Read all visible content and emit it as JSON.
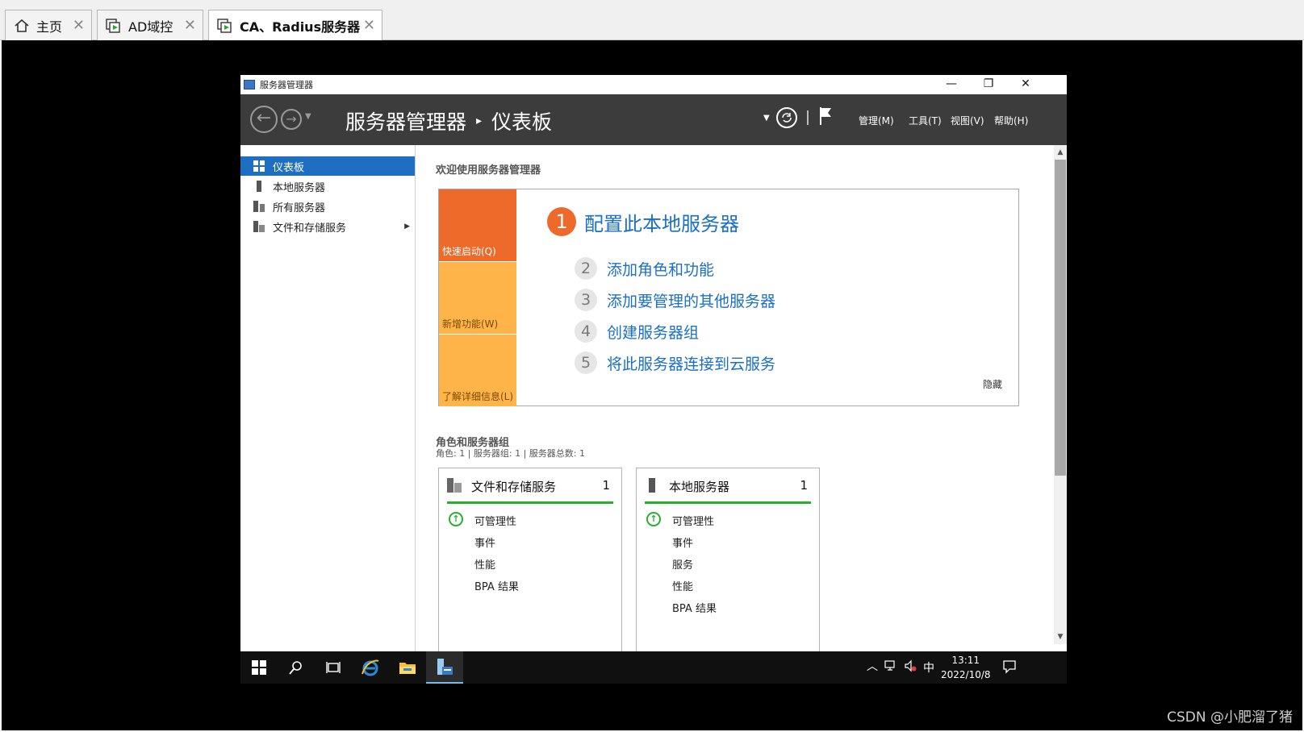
{
  "vm_tabs": [
    {
      "label": "主页"
    },
    {
      "label": "AD域控"
    },
    {
      "label": "CA、Radius服务器"
    }
  ],
  "window": {
    "title": "服务器管理器",
    "controls": {
      "minimize": "—",
      "restore": "❐",
      "close": "✕"
    }
  },
  "header": {
    "breadcrumb_app": "服务器管理器",
    "breadcrumb_sep": "▸",
    "breadcrumb_page": "仪表板",
    "menus": [
      "管理(M)",
      "工具(T)",
      "视图(V)",
      "帮助(H)"
    ],
    "refresh_icon": "refresh-icon",
    "flag_icon": "flag-icon"
  },
  "nav": {
    "items": [
      {
        "label": "仪表板",
        "icon": "dashboard-icon",
        "active": true
      },
      {
        "label": "本地服务器",
        "icon": "server-icon"
      },
      {
        "label": "所有服务器",
        "icon": "servers-icon"
      },
      {
        "label": "文件和存储服务",
        "icon": "file-storage-icon",
        "expand": "▶"
      }
    ]
  },
  "welcome": {
    "heading": "欢迎使用服务器管理器",
    "tiles": [
      "快速启动(Q)",
      "新增功能(W)",
      "了解详细信息(L)"
    ],
    "steps": [
      {
        "num": "1",
        "label": "配置此本地服务器"
      },
      {
        "num": "2",
        "label": "添加角色和功能"
      },
      {
        "num": "3",
        "label": "添加要管理的其他服务器"
      },
      {
        "num": "4",
        "label": "创建服务器组"
      },
      {
        "num": "5",
        "label": "将此服务器连接到云服务"
      }
    ],
    "hide": "隐藏"
  },
  "roles": {
    "title": "角色和服务器组",
    "summary": "角色: 1 | 服务器组: 1 | 服务器总数: 1",
    "cards": [
      {
        "title": "文件和存储服务",
        "count": "1",
        "rows": [
          "可管理性",
          "事件",
          "性能",
          "BPA 结果"
        ]
      },
      {
        "title": "本地服务器",
        "count": "1",
        "rows": [
          "可管理性",
          "事件",
          "服务",
          "性能",
          "BPA 结果"
        ]
      }
    ]
  },
  "taskbar": {
    "time": "13:11",
    "date": "2022/10/8",
    "ime": "中"
  },
  "watermark": "CSDN @小肥溜了猪",
  "colors": {
    "accent": "#1e6fc2",
    "orange": "#ee6a2a",
    "amber": "#ffb44a",
    "ok_green": "#27b02a"
  }
}
